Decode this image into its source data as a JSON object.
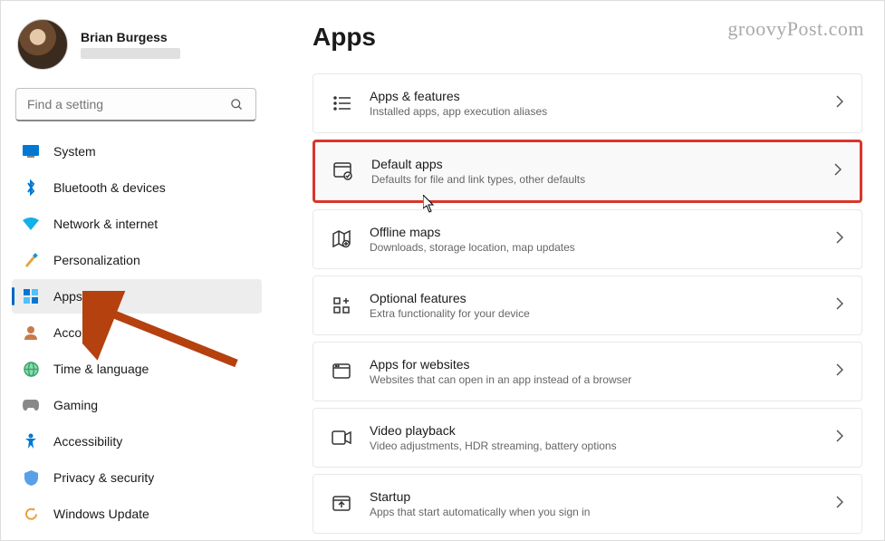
{
  "watermark": "groovyPost.com",
  "profile": {
    "name": "Brian Burgess"
  },
  "search": {
    "placeholder": "Find a setting"
  },
  "nav": [
    {
      "label": "System"
    },
    {
      "label": "Bluetooth & devices"
    },
    {
      "label": "Network & internet"
    },
    {
      "label": "Personalization"
    },
    {
      "label": "Apps"
    },
    {
      "label": "Accounts"
    },
    {
      "label": "Time & language"
    },
    {
      "label": "Gaming"
    },
    {
      "label": "Accessibility"
    },
    {
      "label": "Privacy & security"
    },
    {
      "label": "Windows Update"
    }
  ],
  "page": {
    "title": "Apps"
  },
  "cards": [
    {
      "title": "Apps & features",
      "sub": "Installed apps, app execution aliases"
    },
    {
      "title": "Default apps",
      "sub": "Defaults for file and link types, other defaults"
    },
    {
      "title": "Offline maps",
      "sub": "Downloads, storage location, map updates"
    },
    {
      "title": "Optional features",
      "sub": "Extra functionality for your device"
    },
    {
      "title": "Apps for websites",
      "sub": "Websites that can open in an app instead of a browser"
    },
    {
      "title": "Video playback",
      "sub": "Video adjustments, HDR streaming, battery options"
    },
    {
      "title": "Startup",
      "sub": "Apps that start automatically when you sign in"
    }
  ],
  "highlight": {
    "color": "#d9362b"
  }
}
